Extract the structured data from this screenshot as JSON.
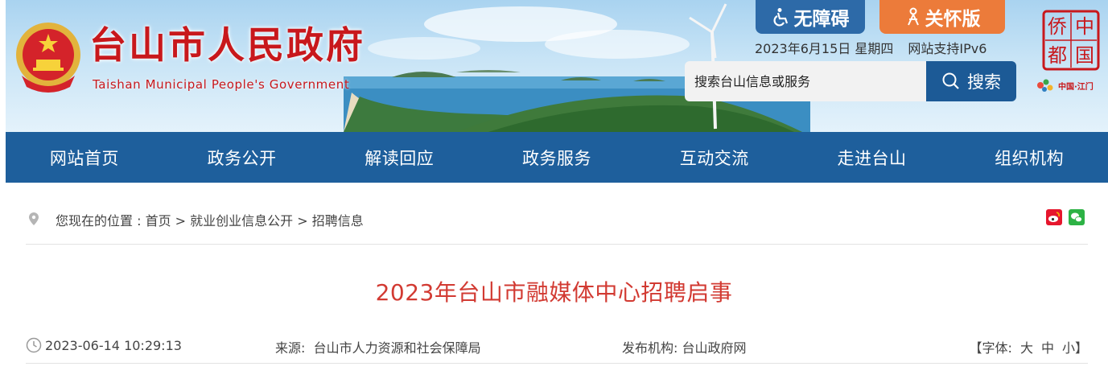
{
  "header": {
    "title": "台山市人民政府",
    "subtitle": "Taishan Municipal People's Government",
    "accessibility_label": "无障碍",
    "care_label": "关怀版",
    "date": "2023年6月15日 星期四",
    "ipv6": "网站支持IPv6",
    "search_placeholder": "搜索台山信息或服务",
    "search_button": "搜索",
    "qiao_logo_chars": [
      "侨",
      "中",
      "都",
      "国"
    ],
    "cn_jm_text": "中国·江门"
  },
  "nav": {
    "items": [
      "网站首页",
      "政务公开",
      "解读回应",
      "政务服务",
      "互动交流",
      "走进台山",
      "组织机构"
    ]
  },
  "breadcrumb": {
    "prefix": "您现在的位置 : ",
    "items": [
      "首页",
      "就业创业信息公开",
      "招聘信息"
    ],
    "separator": " > "
  },
  "article": {
    "title": "2023年台山市融媒体中心招聘启事",
    "datetime": "2023-06-14 10:29:13",
    "source_label": "来源:",
    "source": "台山市人力资源和社会保障局",
    "publisher_label": "发布机构:",
    "publisher": "台山政府网",
    "font_label": "【字体:",
    "font_sizes": [
      "大",
      "中",
      "小"
    ],
    "font_end": "】"
  },
  "colors": {
    "brand_red": "#c8181c",
    "nav_blue": "#1e5f9c",
    "access_blue": "#2d6aa8",
    "care_orange": "#ec7b3a",
    "title_red": "#d23a32"
  },
  "icons": [
    "national-emblem-icon",
    "wheelchair-icon",
    "ribbon-person-icon",
    "search-icon",
    "location-pin-icon",
    "weibo-icon",
    "wechat-icon",
    "clock-icon"
  ]
}
